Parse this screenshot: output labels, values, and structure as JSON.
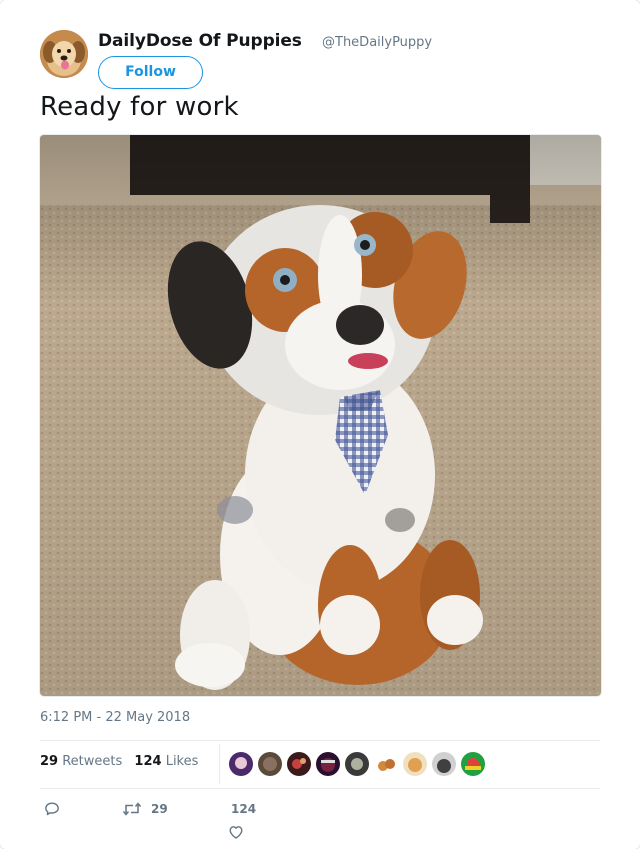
{
  "tweet": {
    "display_name": "DailyDose Of Puppies",
    "handle": "@TheDailyPuppy",
    "follow_label": "Follow",
    "text": "Ready for work",
    "timestamp": "6:12 PM - 22 May 2018"
  },
  "stats": {
    "retweets_count": "29",
    "retweets_label": "Retweets",
    "likes_count": "124",
    "likes_label": "Likes"
  },
  "actions": {
    "retweet_count": "29",
    "like_count": "124"
  },
  "icons": {
    "reply": "reply-icon",
    "retweet": "retweet-icon",
    "like": "heart-icon"
  },
  "colors": {
    "accent": "#1b95e0",
    "text": "#14171a",
    "muted": "#657786",
    "divider": "#e6ecf0"
  }
}
